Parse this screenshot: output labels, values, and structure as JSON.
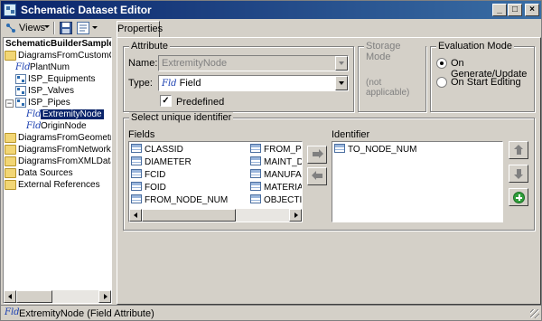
{
  "window": {
    "title": "Schematic Dataset Editor"
  },
  "toolbar": {
    "views_label": "Views"
  },
  "tree": {
    "root": "SchematicBuilderSamples",
    "nodes": [
      "DiagramsFromCustomQueri",
      "PlantNum",
      "ISP_Equipments",
      "ISP_Valves",
      "ISP_Pipes",
      "ExtremityNode",
      "OriginNode",
      "DiagramsFromGeometricNe",
      "DiagramsFromNetworkData",
      "DiagramsFromXMLData",
      "Data Sources",
      "External References"
    ],
    "fld_glyph": "Fld"
  },
  "tabs": {
    "properties": "Properties"
  },
  "attribute": {
    "group_label": "Attribute",
    "name_label": "Name:",
    "name_value": "ExtremityNode",
    "type_label": "Type:",
    "type_value": "Field",
    "predefined_label": "Predefined",
    "predefined_checked": true
  },
  "storage": {
    "group_label": "Storage Mode",
    "value": "(not applicable)"
  },
  "evaluation": {
    "group_label": "Evaluation Mode",
    "option1": "On Generate/Update",
    "option2": "On Start Editing",
    "selected": "On Generate/Update"
  },
  "identifier_group": {
    "group_label": "Select unique identifier",
    "fields_label": "Fields",
    "identifier_label": "Identifier",
    "fields_col1": [
      "CLASSID",
      "DIAMETER",
      "FCID",
      "FOID",
      "FROM_NODE_NUM"
    ],
    "fields_col2": [
      "FROM_PC",
      "MAINT_DA",
      "MANUFAC",
      "MATERIAL",
      "OBJECTID"
    ],
    "identifiers": [
      "TO_NODE_NUM"
    ]
  },
  "status": {
    "text": "ExtremityNode (Field Attribute)"
  }
}
